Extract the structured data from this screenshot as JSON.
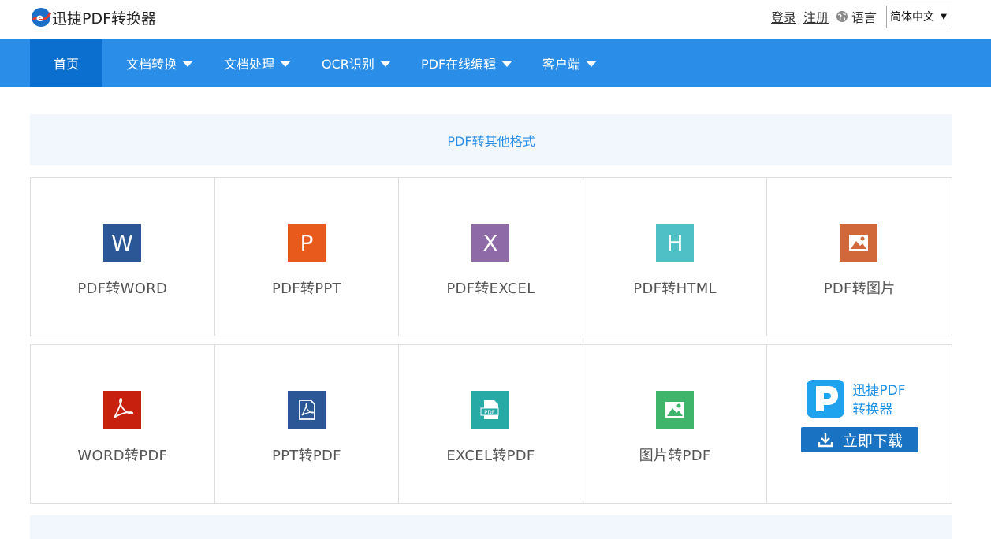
{
  "header": {
    "app_title": "迅捷PDF转换器",
    "login": "登录",
    "register": "注册",
    "language_label": "语言",
    "language_selected": "简体中文"
  },
  "nav": {
    "items": [
      {
        "label": "首页",
        "active": true,
        "dropdown": false
      },
      {
        "label": "文档转换",
        "active": false,
        "dropdown": true
      },
      {
        "label": "文档处理",
        "active": false,
        "dropdown": true
      },
      {
        "label": "OCR识别",
        "active": false,
        "dropdown": true
      },
      {
        "label": "PDF在线编辑",
        "active": false,
        "dropdown": true
      },
      {
        "label": "客户端",
        "active": false,
        "dropdown": true
      }
    ]
  },
  "section": {
    "title": "PDF转其他格式"
  },
  "row1": [
    {
      "label": "PDF转WORD",
      "icon": "word-icon",
      "glyph": "W",
      "color": "#2b5797"
    },
    {
      "label": "PDF转PPT",
      "icon": "ppt-icon",
      "glyph": "P",
      "color": "#e85a1c"
    },
    {
      "label": "PDF转EXCEL",
      "icon": "excel-icon",
      "glyph": "X",
      "color": "#8e6aa6"
    },
    {
      "label": "PDF转HTML",
      "icon": "html-icon",
      "glyph": "H",
      "color": "#4fc1c6"
    },
    {
      "label": "PDF转图片",
      "icon": "image-icon",
      "glyph": "",
      "color": "#d0683a"
    }
  ],
  "row2": [
    {
      "label": "WORD转PDF",
      "icon": "acrobat-icon",
      "color": "#c8200f"
    },
    {
      "label": "PPT转PDF",
      "icon": "pdf-doc-icon",
      "color": "#2b5797"
    },
    {
      "label": "EXCEL转PDF",
      "icon": "pdf-file-icon",
      "color": "#27a9a5"
    },
    {
      "label": "图片转PDF",
      "icon": "picture-icon",
      "color": "#3fb46b"
    }
  ],
  "promo": {
    "title_line1": "迅捷PDF",
    "title_line2": "转换器",
    "download_label": "立即下载"
  }
}
